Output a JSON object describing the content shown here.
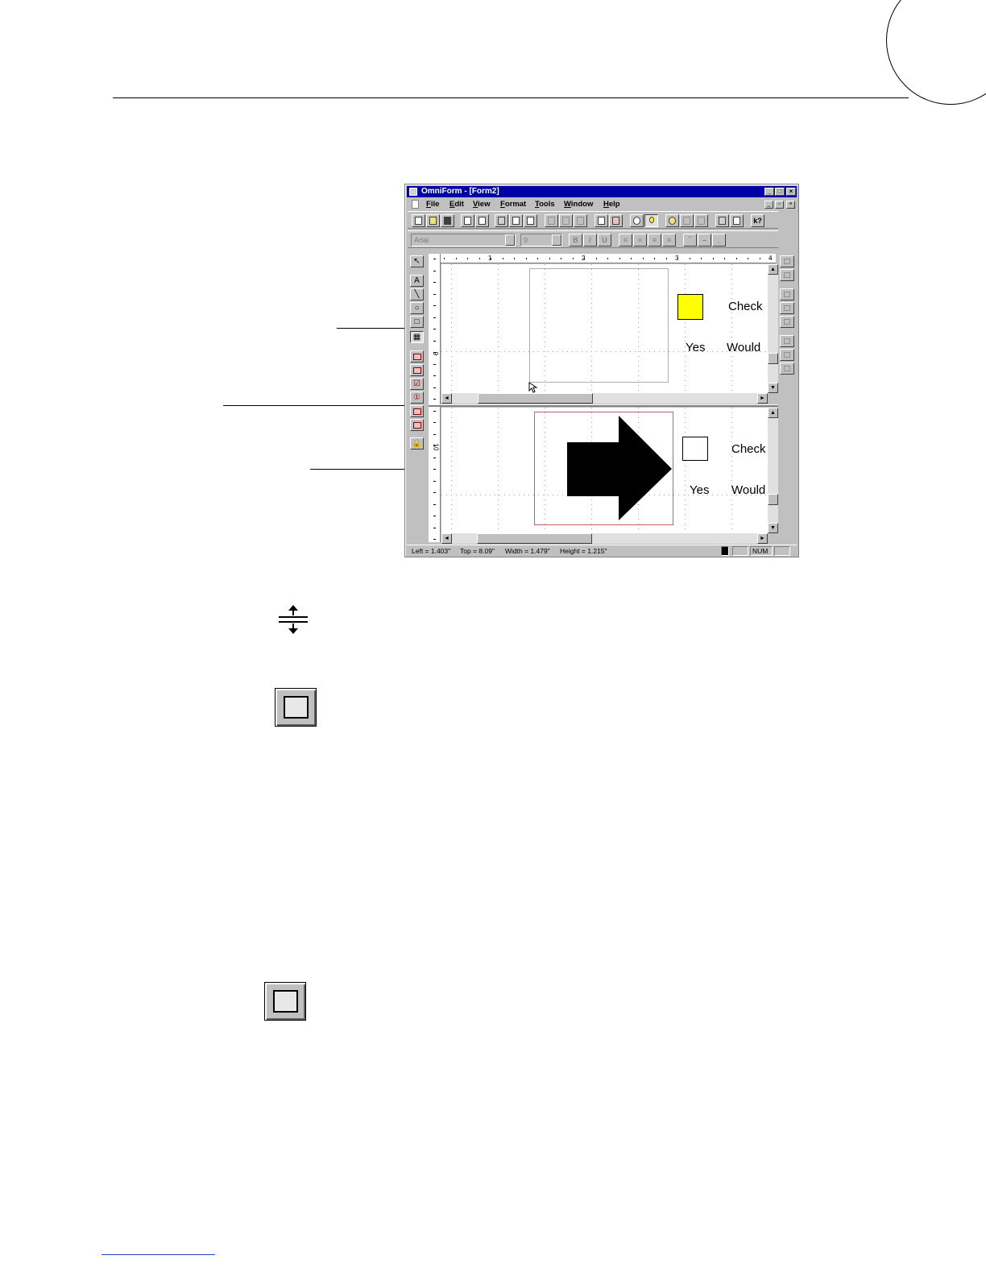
{
  "window": {
    "title": "OmniForm - [Form2]",
    "menu": [
      "File",
      "Edit",
      "View",
      "Format",
      "Tools",
      "Window",
      "Help"
    ],
    "font_name": "Arial",
    "font_size": "9"
  },
  "ruler": {
    "h_labels": [
      "1",
      "2",
      "3",
      "4"
    ],
    "v_labels": [
      "9",
      "10"
    ]
  },
  "top_pane": {
    "checkbox_color": "#ffff00",
    "check_label": "Check",
    "yes_label": "Yes",
    "would_label": "Would"
  },
  "bottom_pane": {
    "check_label": "Check",
    "yes_label": "Yes",
    "would_label": "Would"
  },
  "status": {
    "left": "Left = 1.403\"",
    "top": "Top = 8.09\"",
    "width": "Width = 1.479\"",
    "height": "Height = 1.215\"",
    "num": "NUM"
  },
  "icons": {
    "split": "split-pane-cursor-icon",
    "picture_tool": "picture-tool-icon"
  }
}
